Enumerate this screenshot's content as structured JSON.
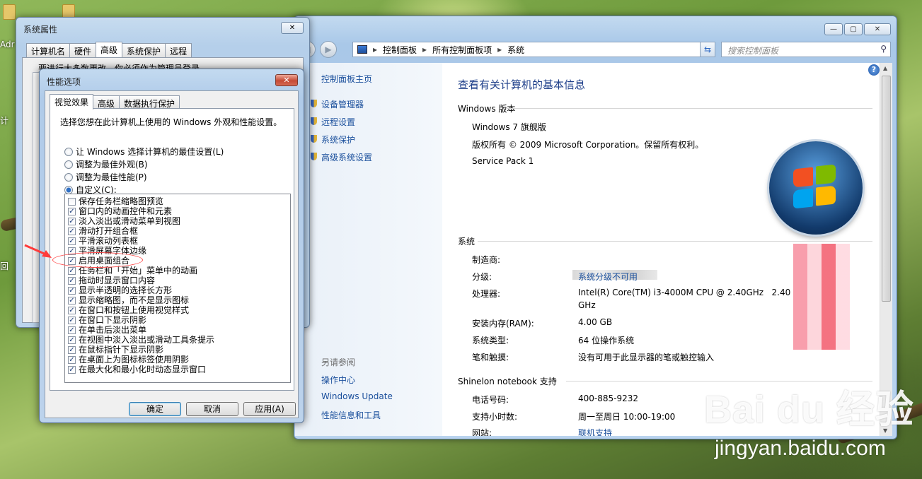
{
  "desktop": {
    "labels": [
      "Adr",
      "计",
      "回"
    ]
  },
  "control_panel": {
    "address": {
      "crumbs": [
        "控制面板",
        "所有控制面板项",
        "系统"
      ],
      "separator": "▸"
    },
    "search_placeholder": "搜索控制面板",
    "left_nav": {
      "home": "控制面板主页",
      "links": [
        "设备管理器",
        "远程设置",
        "系统保护",
        "高级系统设置"
      ],
      "see_also_title": "另请参阅",
      "see_also": [
        "操作中心",
        "Windows Update",
        "性能信息和工具"
      ]
    },
    "main": {
      "title": "查看有关计算机的基本信息",
      "edition_section": "Windows 版本",
      "edition": "Windows 7 旗舰版",
      "copyright": "版权所有 © 2009 Microsoft Corporation。保留所有权利。",
      "service_pack": "Service Pack 1",
      "system_section": "系统",
      "rows": [
        {
          "label": "制造商:",
          "value": ""
        },
        {
          "label": "分级:",
          "value": "系统分级不可用",
          "link": true
        },
        {
          "label": "处理器:",
          "value": "Intel(R) Core(TM) i3-4000M CPU @ 2.40GHz   2.40",
          "value2": "GHz"
        },
        {
          "label": "安装内存(RAM):",
          "value": "4.00 GB"
        },
        {
          "label": "系统类型:",
          "value": "64 位操作系统"
        },
        {
          "label": "笔和触摸:",
          "value": "没有可用于此显示器的笔或触控输入"
        }
      ],
      "support_section": "Shinelon notebook 支持",
      "support_rows": [
        {
          "label": "电话号码:",
          "value": "400-885-9232"
        },
        {
          "label": "支持小时数:",
          "value": "周一至周日 10:00-19:00"
        },
        {
          "label": "网站:",
          "value": "联机支持",
          "link": true
        }
      ]
    }
  },
  "system_properties": {
    "title": "系统属性",
    "tabs": [
      "计算机名",
      "硬件",
      "高级",
      "系统保护",
      "远程"
    ],
    "active_tab": 2,
    "note": "要进行大多数更改，你必须作为管理员登录。"
  },
  "performance_options": {
    "title": "性能选项",
    "tabs": [
      "视觉效果",
      "高级",
      "数据执行保护"
    ],
    "active_tab": 0,
    "description": "选择您想在此计算机上使用的 Windows 外观和性能设置。",
    "radios": [
      {
        "label": "让 Windows 选择计算机的最佳设置(L)",
        "selected": false
      },
      {
        "label": "调整为最佳外观(B)",
        "selected": false
      },
      {
        "label": "调整为最佳性能(P)",
        "selected": false
      },
      {
        "label": "自定义(C):",
        "selected": true
      }
    ],
    "checkboxes": [
      {
        "label": "保存任务栏缩略图预览",
        "checked": false
      },
      {
        "label": "窗口内的动画控件和元素",
        "checked": true
      },
      {
        "label": "淡入淡出或滑动菜单到视图",
        "checked": true
      },
      {
        "label": "滑动打开组合框",
        "checked": true
      },
      {
        "label": "平滑滚动列表框",
        "checked": true
      },
      {
        "label": "平滑屏幕字体边缘",
        "checked": true
      },
      {
        "label": "启用桌面组合",
        "checked": true
      },
      {
        "label": "任务栏和「开始」菜单中的动画",
        "checked": true
      },
      {
        "label": "拖动时显示窗口内容",
        "checked": true
      },
      {
        "label": "显示半透明的选择长方形",
        "checked": true
      },
      {
        "label": "显示缩略图，而不是显示图标",
        "checked": true
      },
      {
        "label": "在窗口和按钮上使用视觉样式",
        "checked": true
      },
      {
        "label": "在窗口下显示阴影",
        "checked": true
      },
      {
        "label": "在单击后淡出菜单",
        "checked": true
      },
      {
        "label": "在视图中淡入淡出或滑动工具条提示",
        "checked": true
      },
      {
        "label": "在鼠标指针下显示阴影",
        "checked": true
      },
      {
        "label": "在桌面上为图标标签使用阴影",
        "checked": true
      },
      {
        "label": "在最大化和最小化时动态显示窗口",
        "checked": true
      }
    ],
    "buttons": {
      "ok": "确定",
      "cancel": "取消",
      "apply": "应用(A)"
    },
    "check_mark": "✓"
  },
  "watermark": {
    "text": "Bai du 经验",
    "url": "jingyan.baidu.com"
  },
  "colors": {
    "link": "#1a4f9c",
    "highlight": "#ff4d4d"
  }
}
